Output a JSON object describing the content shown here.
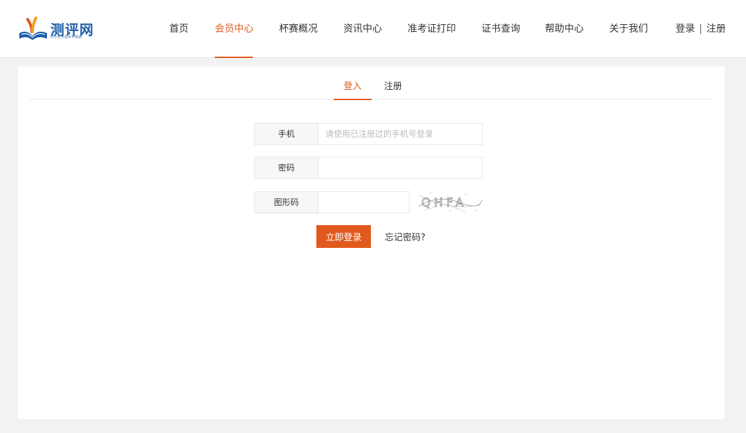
{
  "header": {
    "logo": {
      "name": "测评网",
      "subtitle": "中小学学业水平测试"
    },
    "nav": [
      {
        "label": "首页"
      },
      {
        "label": "会员中心"
      },
      {
        "label": "杯赛概况"
      },
      {
        "label": "资讯中心"
      },
      {
        "label": "准考证打印"
      },
      {
        "label": "证书查询"
      },
      {
        "label": "帮助中心"
      },
      {
        "label": "关于我们"
      }
    ],
    "active_nav": "会员中心",
    "auth": {
      "login": "登录",
      "separator": "|",
      "register": "注册"
    }
  },
  "tabs": {
    "login": "登入",
    "register": "注册",
    "active": "登入"
  },
  "form": {
    "phone_label": "手机",
    "phone_placeholder": "请使用已注册过的手机号登录",
    "phone_value": "",
    "password_label": "密码",
    "password_value": "",
    "captcha_label": "图形码",
    "captcha_value": "",
    "captcha_text": "QHFA",
    "submit": "立即登录",
    "forgot": "忘记密码?"
  },
  "colors": {
    "accent": "#e05a1e",
    "logo_blue": "#1f5fa8",
    "background": "#f2f2f2"
  }
}
